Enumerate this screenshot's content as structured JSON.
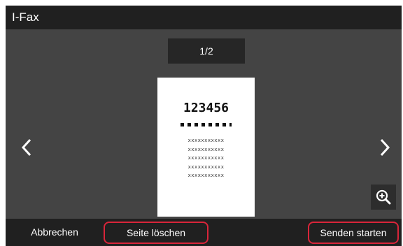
{
  "window": {
    "title": "I-Fax"
  },
  "preview": {
    "page_indicator": "1/2",
    "document": {
      "number": "123456",
      "lines": [
        "xxxxxxxxxxx",
        "xxxxxxxxxxx",
        "xxxxxxxxxxx",
        "xxxxxxxxxxx",
        "xxxxxxxxxxx"
      ]
    }
  },
  "icons": {
    "prev": "chevron-left-icon",
    "next": "chevron-right-icon",
    "zoom": "zoom-in-icon"
  },
  "footer": {
    "cancel_label": "Abbrechen",
    "delete_page_label": "Seite löschen",
    "start_send_label": "Senden starten"
  },
  "colors": {
    "screen_background": "#444444",
    "bar_background": "#202020",
    "highlight": "#d9253a"
  }
}
